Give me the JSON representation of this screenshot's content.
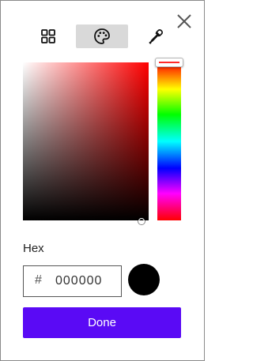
{
  "close": {
    "icon": "close-icon"
  },
  "modes": [
    {
      "id": "grid",
      "icon": "grid-icon",
      "active": false
    },
    {
      "id": "palette",
      "icon": "palette-icon",
      "active": true
    },
    {
      "id": "eyedropper",
      "icon": "eyedropper-icon",
      "active": false
    }
  ],
  "picker": {
    "hue_color": "#ff0000",
    "selected_color": "#000000"
  },
  "hex": {
    "label": "Hex",
    "prefix": "#",
    "value": "000000"
  },
  "done_button": {
    "label": "Done",
    "color": "#5a0af5"
  }
}
